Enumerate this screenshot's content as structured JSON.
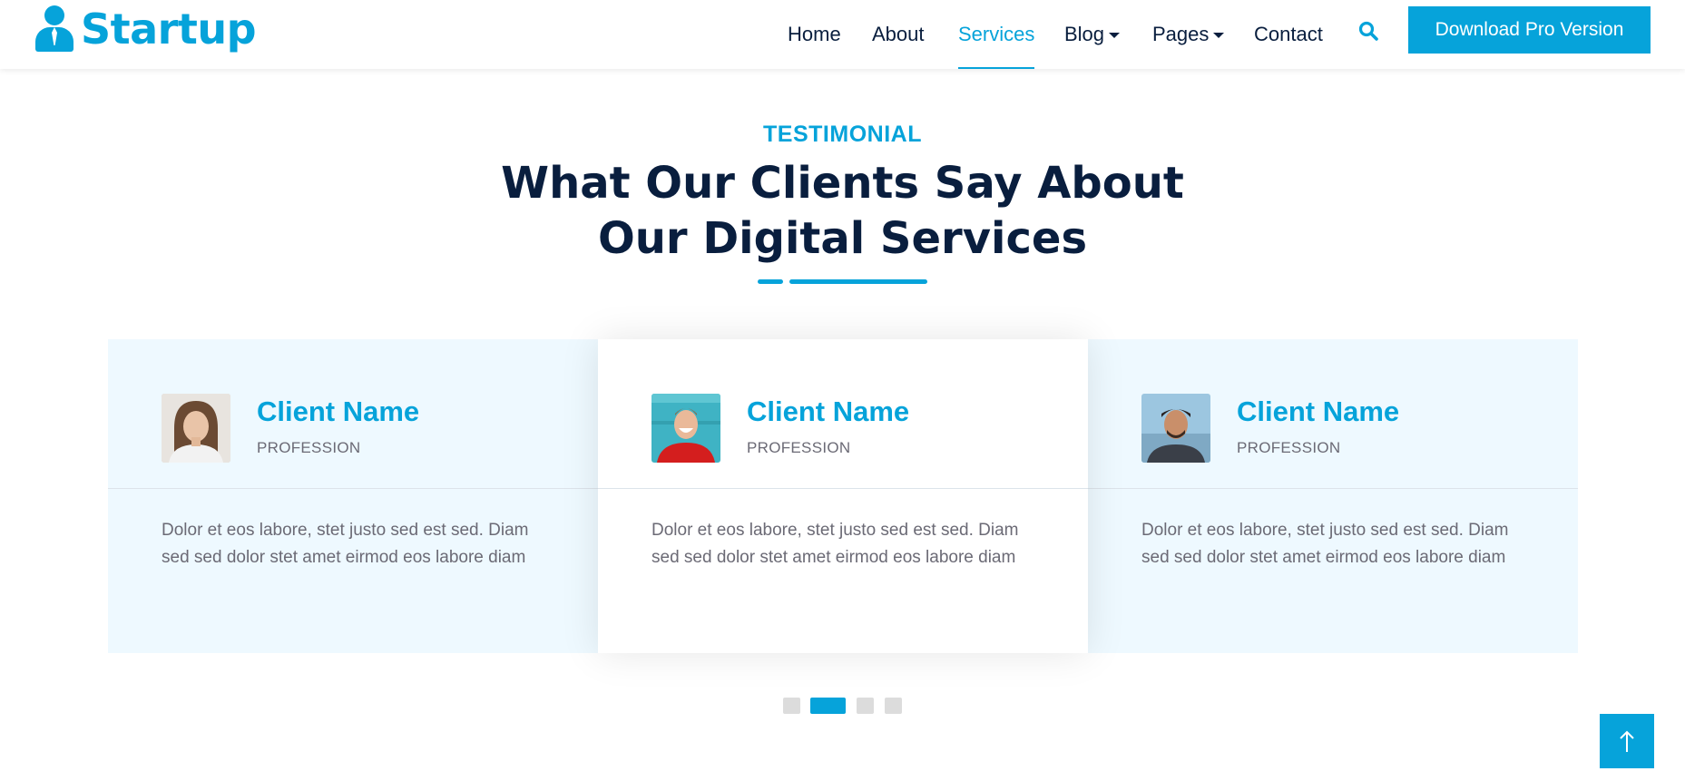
{
  "brand": {
    "name": "Startup",
    "icon": "user-tie-icon",
    "color": "#06a3da"
  },
  "nav": {
    "items": [
      {
        "label": "Home",
        "active": false,
        "dropdown": false
      },
      {
        "label": "About",
        "active": false,
        "dropdown": false
      },
      {
        "label": "Services",
        "active": true,
        "dropdown": false
      },
      {
        "label": "Blog",
        "active": false,
        "dropdown": true
      },
      {
        "label": "Pages",
        "active": false,
        "dropdown": true
      },
      {
        "label": "Contact",
        "active": false,
        "dropdown": false
      }
    ],
    "search_icon": "search-icon",
    "cta_label": "Download Pro Version"
  },
  "testimonial": {
    "subtitle": "TESTIMONIAL",
    "title_line1": "What Our Clients Say About",
    "title_line2": "Our Digital Services",
    "cards": [
      {
        "name": "Client Name",
        "profession": "PROFESSION",
        "text": "Dolor et eos labore, stet justo sed est sed. Diam sed sed dolor stet amet eirmod eos labore diam",
        "highlighted": false
      },
      {
        "name": "Client Name",
        "profession": "PROFESSION",
        "text": "Dolor et eos labore, stet justo sed est sed. Diam sed sed dolor stet amet eirmod eos labore diam",
        "highlighted": true
      },
      {
        "name": "Client Name",
        "profession": "PROFESSION",
        "text": "Dolor et eos labore, stet justo sed est sed. Diam sed sed dolor stet amet eirmod eos labore diam",
        "highlighted": false
      }
    ],
    "carousel": {
      "total_pages": 4,
      "active_page": 2
    }
  },
  "back_to_top": {
    "icon": "arrow-up-icon"
  },
  "colors": {
    "primary": "#06a3da",
    "dark": "#091e3e",
    "muted": "#6b6a75",
    "card_bg": "#eef9ff"
  }
}
